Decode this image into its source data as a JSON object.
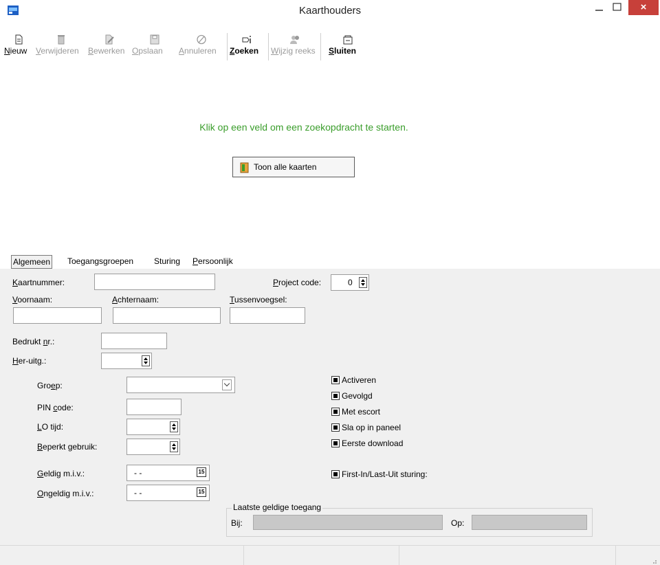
{
  "window": {
    "title": "Kaarthouders",
    "close_glyph": "×"
  },
  "toolbar": [
    {
      "key": "nieuw",
      "label": "Nieuw",
      "accel": "N",
      "rest": "ieuw",
      "icon": "new-document-icon",
      "enabled": true
    },
    {
      "key": "verwijderen",
      "label": "Verwijderen",
      "accel": "V",
      "rest": "erwijderen",
      "icon": "delete-icon",
      "enabled": false
    },
    {
      "key": "bewerken",
      "label": "Bewerken",
      "accel": "B",
      "rest": "ewerken",
      "icon": "edit-icon",
      "enabled": false
    },
    {
      "key": "opslaan",
      "label": "Opslaan",
      "accel": "O",
      "rest": "pslaan",
      "icon": "save-icon",
      "enabled": false
    },
    {
      "key": "annuleren",
      "label": "Annuleren",
      "accel": "A",
      "rest": "nnuleren",
      "icon": "cancel-icon",
      "enabled": false
    },
    {
      "key": "zoeken",
      "label": "Zoeken",
      "accel": "Z",
      "rest": "oeken",
      "icon": "search-icon",
      "enabled": true
    },
    {
      "key": "wijzig-reeks",
      "label": "Wijzig reeks",
      "accel": "W",
      "rest": "ijzig reeks",
      "icon": "users-icon",
      "enabled": false
    },
    {
      "key": "sluiten",
      "label": "Sluiten",
      "accel": "S",
      "rest": "luiten",
      "icon": "close-window-icon",
      "enabled": true
    }
  ],
  "search": {
    "message": "Klik op een veld om een zoekopdracht te starten.",
    "show_all_label": "Toon alle kaarten"
  },
  "tabs": [
    {
      "key": "algemeen",
      "label": "Algemeen",
      "active": true
    },
    {
      "key": "toegangsgroepen",
      "label": "Toegangsgroepen",
      "active": false
    },
    {
      "key": "sturing",
      "label": "Sturing",
      "active": false
    },
    {
      "key": "persoonlijk",
      "label": "Persoonlijk",
      "accel": "P",
      "rest": "ersoonlijk",
      "active": false
    }
  ],
  "form": {
    "kaartnummer": {
      "label_accel": "K",
      "label_rest": "aartnummer:",
      "value": ""
    },
    "project_code": {
      "label_accel": "P",
      "label_rest": "roject code:",
      "value": "0"
    },
    "voornaam": {
      "label_accel": "V",
      "label_rest": "oornaam:",
      "value": ""
    },
    "achternaam": {
      "label_accel": "A",
      "label_rest": "chternaam:",
      "value": ""
    },
    "tussenvoegsel": {
      "label_accel": "T",
      "label_rest": "ussenvoegsel:",
      "value": ""
    },
    "bedrukt_nr": {
      "label_pre": "Bedrukt ",
      "label_accel": "n",
      "label_rest": "r.:",
      "value": ""
    },
    "her_uitg": {
      "label_accel": "H",
      "label_rest": "er-uitg.:",
      "value": ""
    },
    "groep": {
      "label_pre": "Gro",
      "label_accel": "e",
      "label_rest": "p:",
      "value": ""
    },
    "pin_code": {
      "label_pre": "PIN ",
      "label_accel": "c",
      "label_rest": "ode:",
      "value": ""
    },
    "lo_tijd": {
      "label_accel": "L",
      "label_rest": "O tijd:",
      "value": ""
    },
    "beperkt_gebruik": {
      "label_accel": "B",
      "label_rest": "eperkt gebruik:",
      "value": ""
    },
    "geldig_miv": {
      "label_accel": "G",
      "label_rest": "eldig m.i.v.:",
      "value": "- -"
    },
    "ongeldig_miv": {
      "label_accel": "O",
      "label_rest": "ngeldig m.i.v.:",
      "value": "- -"
    },
    "calendar_glyph": "15"
  },
  "checkboxes": [
    {
      "key": "activeren",
      "label": "Activeren",
      "checked": true
    },
    {
      "key": "gevolgd",
      "label": "Gevolgd",
      "checked": true
    },
    {
      "key": "met-escort",
      "label": "Met escort",
      "checked": true
    },
    {
      "key": "sla-op-in-paneel",
      "label": "Sla op in paneel",
      "checked": true
    },
    {
      "key": "eerste-download",
      "label": "Eerste download",
      "checked": true
    },
    {
      "key": "first-in-last-uit",
      "label": "First-In/Last-Uit sturing:",
      "checked": true
    }
  ],
  "laatste_toegang": {
    "title": "Laatste geldige toegang",
    "bij_label": "Bij:",
    "op_label": "Op:",
    "bij_value": "",
    "op_value": ""
  },
  "colors": {
    "accent_green": "#3a9d2b",
    "close_red": "#c7403a",
    "panel_bg": "#f0f0f0"
  }
}
